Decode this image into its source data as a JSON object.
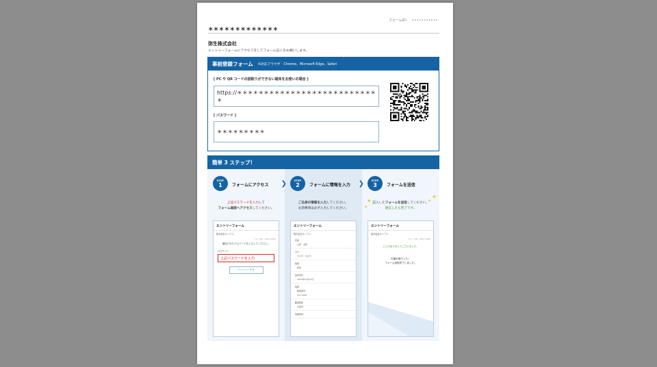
{
  "header": {
    "form_id_label": "フォームID：",
    "form_id_value": "•••••••••••",
    "masked_title": "＊＊＊＊＊＊＊＊＊＊＊＊＊",
    "company": "弥生株式会社",
    "intro": "エントリーフォームにアクセスをしてフォーム記入をお願いします。"
  },
  "registration": {
    "title": "事前登録フォーム",
    "browsers": "※対応ブラウザ　Chrome、Microsoft Edge、Safari",
    "url_label": "[ PC や QR コードの読取りができない端末をお使いの場合 ]",
    "url_value": "https://＊＊＊＊＊＊＊＊＊＊＊＊＊＊＊＊＊＊＊＊＊＊＊＊＊＊＊",
    "password_label": "[ パスワード ]",
    "password_value": "＊＊＊＊＊＊＊＊＊",
    "qr_icon": "qr-code-icon"
  },
  "steps_title": "簡単 3 ステップ！",
  "steps": [
    {
      "step_label": "STEP",
      "num": "1",
      "title": "フォームにアクセス",
      "desc_line1_red": "上記パスワードを入力",
      "desc_line1_rest": "して",
      "desc_line2_bold": "フォーム画面へアクセス",
      "desc_line2_rest": "してください。",
      "mock": {
        "title": "エントリーフォーム",
        "sub": "株式会社サンプル",
        "right": "フォームID：XXXX_0000",
        "guide": "通知されたパスワードを入力してください。",
        "pw_label": "パスワード",
        "pw_placeholder": "上記パスワードを入力",
        "button": "エントリーする"
      }
    },
    {
      "step_label": "STEP",
      "num": "2",
      "title": "フォームに情報を入力",
      "desc_line1_bold": "ご自身の情報を入力",
      "desc_line1_rest": "してください。",
      "desc_line2": "必須事項は必ず入力してください。",
      "mock": {
        "title": "エントリーフォーム",
        "sub": "株式会社サンプル",
        "fields": [
          {
            "label": "氏名",
            "value": "山田　太郎"
          },
          {
            "label": "カナ",
            "value": "ヤマダ　タロウ"
          },
          {
            "label": "性別",
            "value": "男性"
          },
          {
            "label": "生年月日",
            "value": "2001年01月27日"
          },
          {
            "label": "住所",
            "value": "郵便番号"
          },
          {
            "label": "",
            "value": "151-0000"
          },
          {
            "label": "都道府県",
            "value": "大阪府"
          },
          {
            "label": "市区町村",
            "value": ""
          }
        ]
      }
    },
    {
      "step_label": "STEP",
      "num": "3",
      "title": "フォームを送信",
      "desc_line1_pre": "記入した",
      "desc_line1_bold": "フォームを送信",
      "desc_line1_rest": "してください。",
      "desc_line2_green": "送信したら完了です。",
      "mock": {
        "title": "エントリーフォーム",
        "sub": "株式会社サンプル",
        "right": "フォームID：XXXX_0000",
        "ok": "ご入力ありがとうございました。",
        "thanks_1": "お疲れ様でした！",
        "thanks_2": "フォーム送信完了しました。"
      }
    }
  ],
  "colors": {
    "primary": "#1563a3",
    "accent_red": "#dd2222",
    "accent_green": "#3a9a3a",
    "sparkle": "#e8c21c"
  }
}
